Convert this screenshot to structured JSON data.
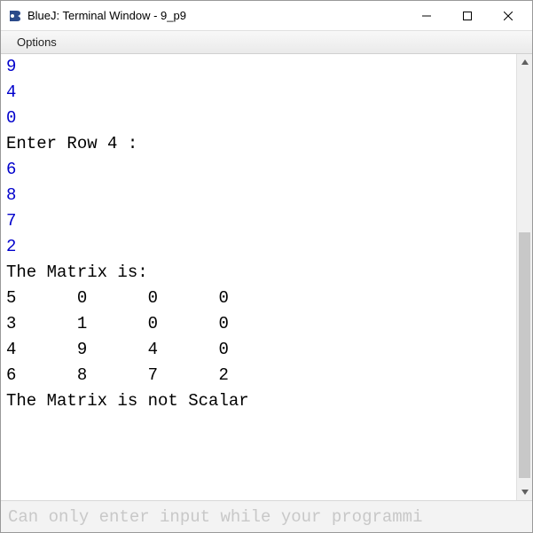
{
  "titlebar": {
    "title": "BlueJ: Terminal Window - 9_p9"
  },
  "menubar": {
    "options": "Options"
  },
  "terminal": {
    "lines": [
      {
        "text": "9",
        "kind": "input"
      },
      {
        "text": "4",
        "kind": "input"
      },
      {
        "text": "0",
        "kind": "input"
      },
      {
        "text": "Enter Row 4 :",
        "kind": "output"
      },
      {
        "text": "6",
        "kind": "input"
      },
      {
        "text": "8",
        "kind": "input"
      },
      {
        "text": "7",
        "kind": "input"
      },
      {
        "text": "2",
        "kind": "input"
      },
      {
        "text": "The Matrix is:",
        "kind": "output"
      },
      {
        "text": "5      0      0      0",
        "kind": "output"
      },
      {
        "text": "3      1      0      0",
        "kind": "output"
      },
      {
        "text": "4      9      4      0",
        "kind": "output"
      },
      {
        "text": "6      8      7      2",
        "kind": "output"
      },
      {
        "text": "The Matrix is not Scalar",
        "kind": "output"
      }
    ]
  },
  "statusbar": {
    "message": "Can only enter input while your programmi"
  }
}
